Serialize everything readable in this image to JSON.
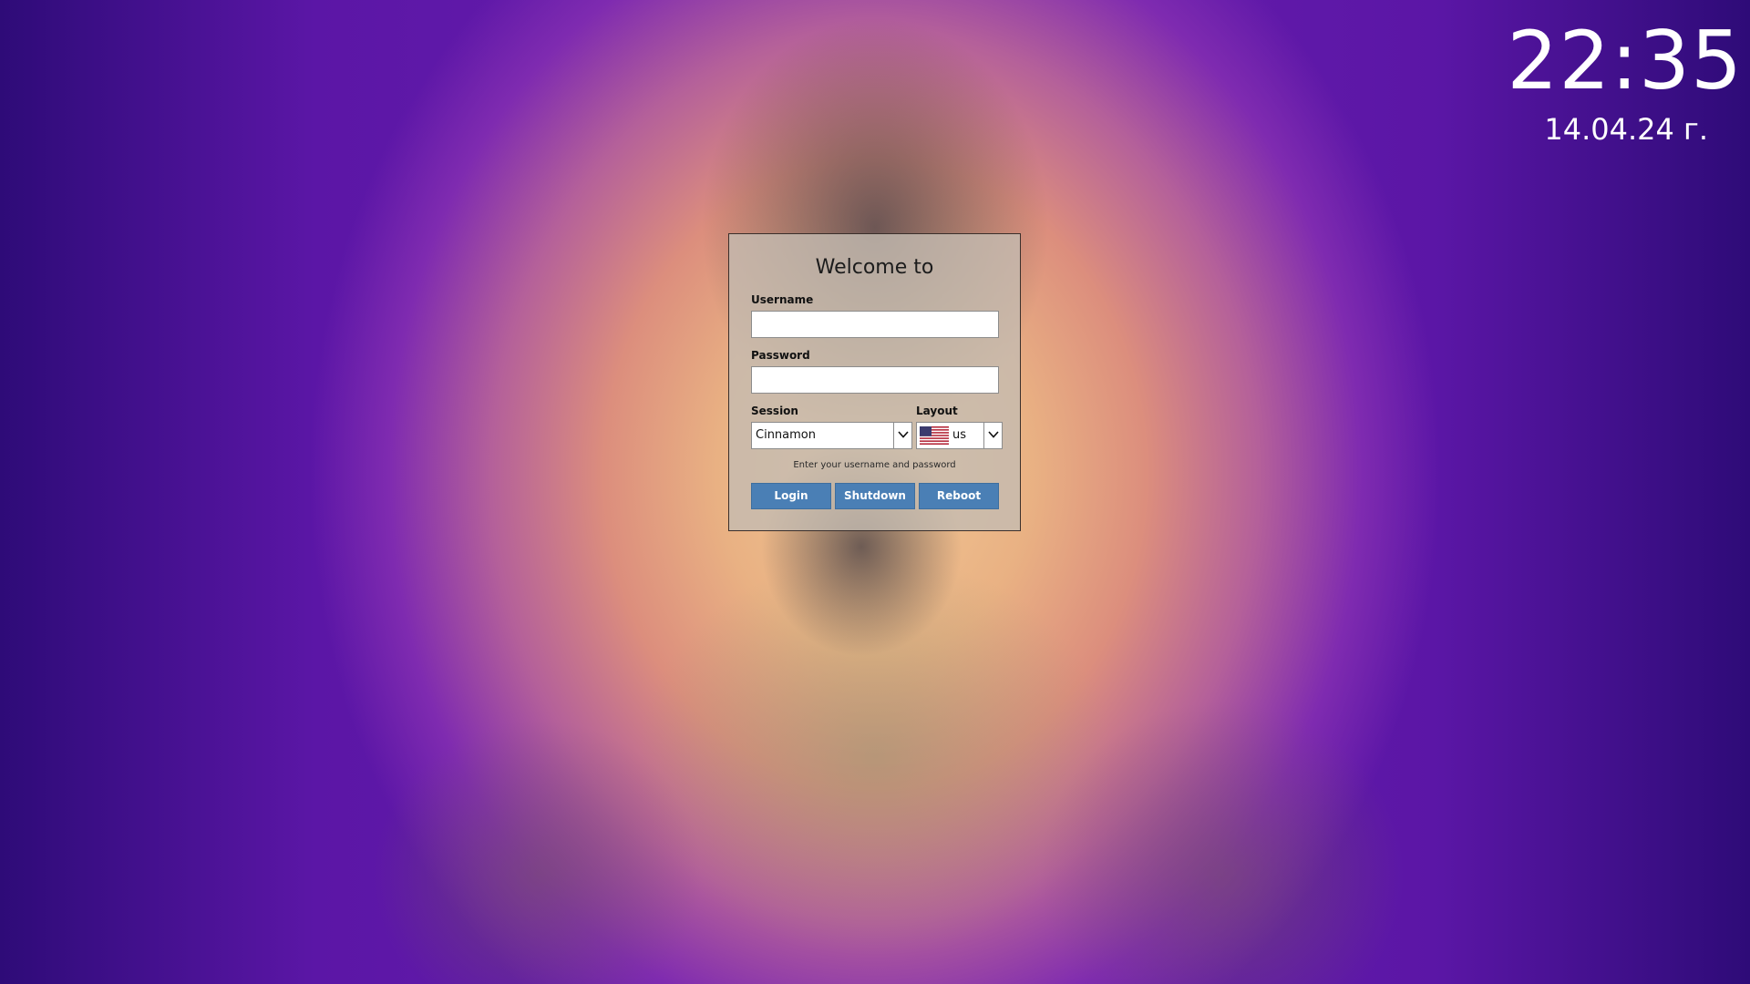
{
  "clock": {
    "time": "22:35",
    "date": "14.04.24 г."
  },
  "login": {
    "title": "Welcome to",
    "username_label": "Username",
    "username_value": "",
    "password_label": "Password",
    "password_value": "",
    "session_label": "Session",
    "session_value": "Cinnamon",
    "layout_label": "Layout",
    "layout_value": "us",
    "layout_flag": "us-flag-icon",
    "hint": "Enter your username and password",
    "buttons": {
      "login": "Login",
      "shutdown": "Shutdown",
      "reboot": "Reboot"
    }
  },
  "colors": {
    "button": "#4a7fb5",
    "panel": "#c4bcb2"
  }
}
